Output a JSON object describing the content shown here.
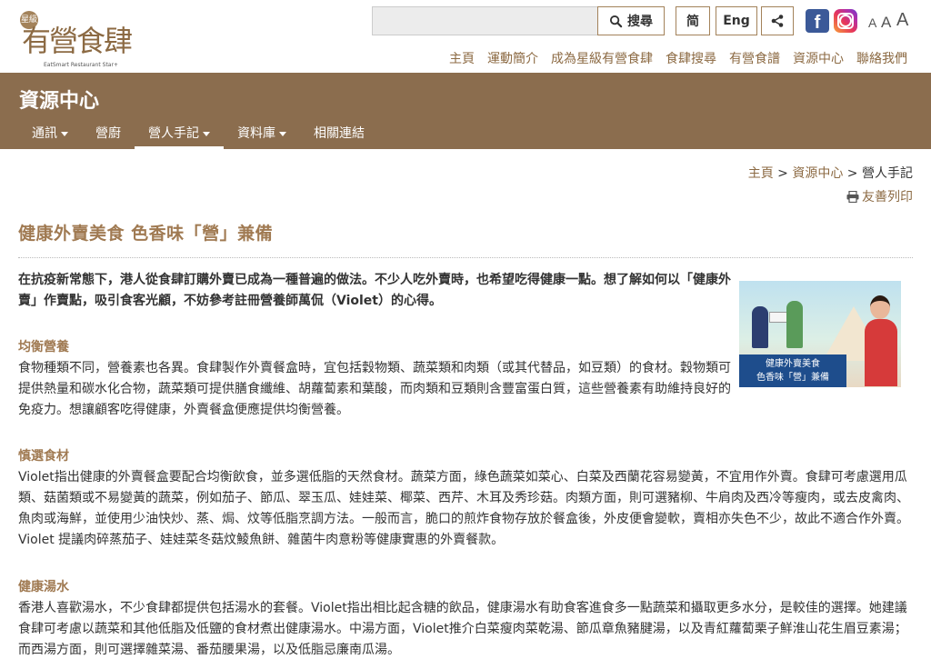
{
  "header": {
    "logo_badge": "星級",
    "logo_text": "有營食肆",
    "logo_sub": "EatSmart Restaurant Star+",
    "search_placeholder": "",
    "search_label": "搜尋",
    "lang_simplified": "简",
    "lang_english": "Eng",
    "font_sizes": [
      "A",
      "A",
      "A"
    ],
    "nav": [
      "主頁",
      "運動簡介",
      "成為星級有營食肆",
      "食肆搜尋",
      "有營食譜",
      "資源中心",
      "聯絡我們"
    ]
  },
  "band": {
    "title": "資源中心",
    "menu": [
      {
        "label": "通訊",
        "dropdown": true
      },
      {
        "label": "營廚",
        "dropdown": false
      },
      {
        "label": "營人手記",
        "dropdown": true,
        "active": true
      },
      {
        "label": "資料庫",
        "dropdown": true
      },
      {
        "label": "相關連結",
        "dropdown": false
      }
    ]
  },
  "breadcrumb": {
    "home": "主頁",
    "sep1": " > ",
    "section": "資源中心",
    "sep2": " > ",
    "current": "營人手記"
  },
  "print_label": "友善列印",
  "article": {
    "title": "健康外賣美食 色香味「營」兼備",
    "intro": "在抗疫新常態下，港人從食肆訂購外賣已成為一種普遍的做法。不少人吃外賣時，也希望吃得健康一點。想了解如何以「健康外賣」作賣點，吸引食客光顧，不妨參考註冊營養師萬侃（Violet）的心得。",
    "hero_caption_line1": "健康外賣美食",
    "hero_caption_line2": "色香味「營」兼備",
    "sections": [
      {
        "heading": "均衡營養",
        "body": "食物種類不同，營養素也各異。食肆製作外賣餐盒時，宜包括穀物類、蔬菜類和肉類（或其代替品，如豆類）的食材。穀物類可提供熱量和碳水化合物，蔬菜類可提供膳食纖維、胡蘿蔔素和葉酸，而肉類和豆類則含豐富蛋白質，這些營養素有助維持良好的免疫力。想讓顧客吃得健康，外賣餐盒便應提供均衡營養。"
      },
      {
        "heading": "慎選食材",
        "body": "Violet指出健康的外賣餐盒要配合均衡飲食，並多選低脂的天然食材。蔬菜方面，綠色蔬菜如菜心、白菜及西蘭花容易變黃，不宜用作外賣。食肆可考慮選用瓜類、菇菌類或不易變黃的蔬菜，例如茄子、節瓜、翠玉瓜、娃娃菜、椰菜、西芹、木耳及秀珍菇。肉類方面，則可選豬柳、牛肩肉及西冷等瘦肉，或去皮禽肉、魚肉或海鮮，並使用少油快炒、蒸、焗、炆等低脂烹調方法。一般而言，脆口的煎炸食物存放於餐盒後，外皮便會變軟，賣相亦失色不少，故此不適合作外賣。Violet 提議肉碎蒸茄子、娃娃菜冬菇炆鯪魚餅、雜菌牛肉意粉等健康實惠的外賣餐款。"
      },
      {
        "heading": "健康湯水",
        "body": "香港人喜歡湯水，不少食肆都提供包括湯水的套餐。Violet指出相比起含糖的飲品，健康湯水有助食客進食多一點蔬菜和攝取更多水分，是較佳的選擇。她建議食肆可考慮以蔬菜和其他低脂及低鹽的食材煮出健康湯水。中湯方面，Violet推介白菜瘦肉菜乾湯、節瓜章魚豬腱湯，以及青紅蘿蔔栗子鮮淮山花生眉豆素湯；而西湯方面，則可選擇雜菜湯、番茄腰果湯，以及低脂忌廉南瓜湯。"
      }
    ]
  },
  "colors": {
    "brand_brown": "#8b6d4e",
    "accent": "#a07a52",
    "link": "#8c6a43"
  }
}
